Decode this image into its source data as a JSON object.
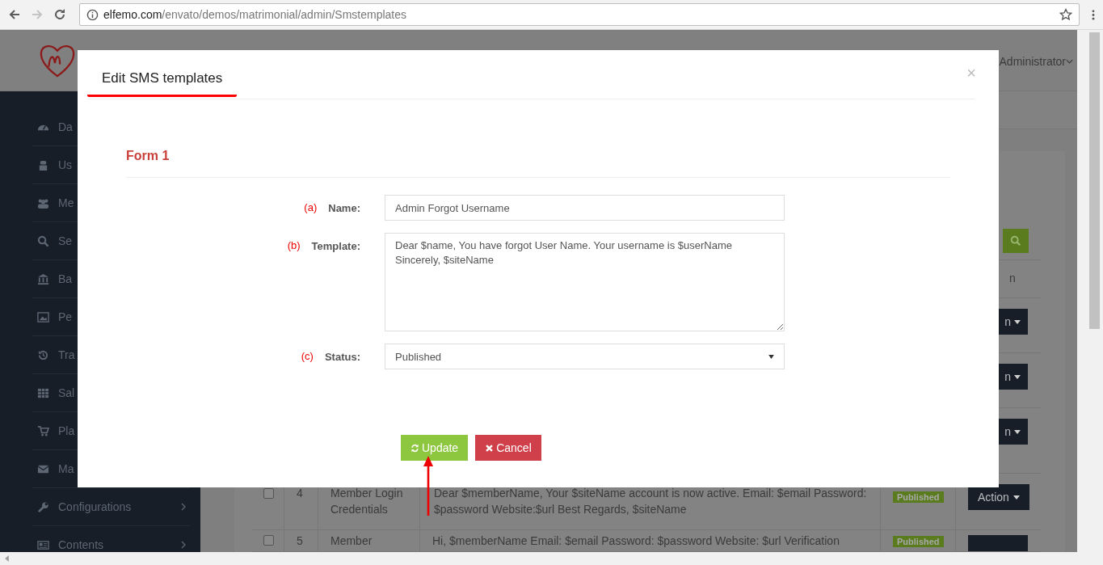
{
  "browser": {
    "url_host": "elfemo.com",
    "url_path": "/envato/demos/matrimonial/admin/Smstemplates",
    "forward_disabled": true
  },
  "header": {
    "user": "Administrator"
  },
  "sidebar": {
    "items": [
      {
        "label": "Da",
        "expandable": false
      },
      {
        "label": "Us",
        "expandable": false
      },
      {
        "label": "Me",
        "expandable": false
      },
      {
        "label": "Se",
        "expandable": false
      },
      {
        "label": "Ba",
        "expandable": false
      },
      {
        "label": "Pe",
        "expandable": false
      },
      {
        "label": "Tra",
        "expandable": false
      },
      {
        "label": "Sal",
        "expandable": false
      },
      {
        "label": "Pla",
        "expandable": false
      },
      {
        "label": "Ma",
        "expandable": false
      },
      {
        "label": "Configurations",
        "expandable": true
      },
      {
        "label": "Contents",
        "expandable": true
      }
    ]
  },
  "table": {
    "column_6": "n",
    "rows": [
      {
        "kind": "covered",
        "action": "n"
      },
      {
        "kind": "covered",
        "action": "n"
      },
      {
        "kind": "covered",
        "action": "n"
      },
      {
        "kind": "full",
        "checked": false,
        "number": "4",
        "name": "Member Login Credentials",
        "template": "Dear $memberName, Your $siteName account is now active. Email: $email Password: $password Website:$url Best Regards, $siteName",
        "status": "Published",
        "action": "Action"
      },
      {
        "kind": "cut",
        "checked": false,
        "number": "5",
        "name": "Member",
        "template": "Hi, $memberName Email: $email Password: $password Website: $url Verification",
        "status": "Published"
      }
    ]
  },
  "modal": {
    "title": "Edit SMS templates",
    "close": "×",
    "form_title": "Form 1",
    "fields": [
      {
        "kind": "input",
        "marker": "(a)",
        "label": "Name:",
        "value": "Admin Forgot Username"
      },
      {
        "kind": "textarea",
        "marker": "(b)",
        "label": "Template:",
        "value": "Dear $name, You have forgot User Name. Your username is $userName\nSincerely, $siteName"
      },
      {
        "kind": "select",
        "marker": "(c)",
        "label": "Status:",
        "value": "Published"
      }
    ],
    "buttons": [
      {
        "kind": "update",
        "label": "Update"
      },
      {
        "kind": "cancel",
        "label": "Cancel"
      }
    ]
  }
}
